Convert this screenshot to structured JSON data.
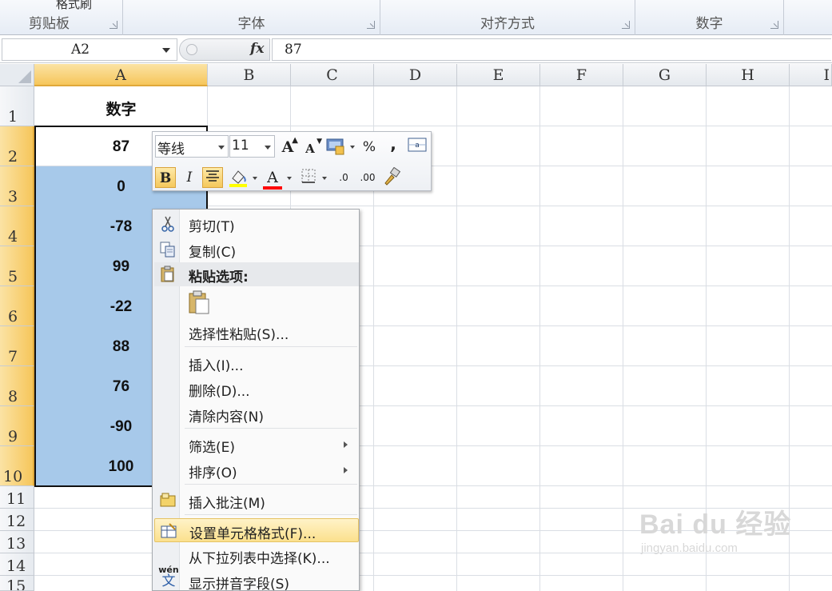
{
  "ribbon": {
    "groups": [
      {
        "label": "剪贴板"
      },
      {
        "label": "字体"
      },
      {
        "label": "对齐方式"
      },
      {
        "label": "数字"
      }
    ],
    "cut_text": "格式刷"
  },
  "formula_bar": {
    "name_box": "A2",
    "fx": "fx",
    "formula": "87"
  },
  "grid": {
    "columns": [
      "A",
      "B",
      "C",
      "D",
      "E",
      "F",
      "G",
      "H",
      "I"
    ],
    "rows": [
      "1",
      "2",
      "3",
      "4",
      "5",
      "6",
      "7",
      "8",
      "9",
      "10",
      "11",
      "12",
      "13",
      "14",
      "15"
    ],
    "cells": {
      "A1": "数字",
      "A2": "87",
      "A3": "0",
      "A4": "-78",
      "A5": "99",
      "A6": "-22",
      "A7": "88",
      "A8": "76",
      "A9": "-90",
      "A10": "100"
    },
    "selected_column": "A",
    "selected_range": "A2:A10",
    "selection_color": "#a7c9ea"
  },
  "mini_toolbar": {
    "font_name": "等线",
    "font_size": "11",
    "grow_font": "A",
    "shrink_font": "A",
    "percent": "%",
    "comma": ",",
    "bold": "B",
    "italic": "I",
    "font_color_letter": "A",
    "highlight_color": "#ffff00",
    "font_color": "#ff0000",
    "decrease_decimal_a": ".0",
    "decrease_decimal_b": ".00"
  },
  "context_menu": {
    "items": [
      {
        "label": "剪切(T)",
        "icon": "scissors-icon"
      },
      {
        "label": "复制(C)",
        "icon": "copy-icon"
      },
      {
        "label": "粘贴选项:",
        "icon": "paste-icon"
      },
      {
        "label": "选择性粘贴(S)...",
        "icon": ""
      },
      {
        "label": "插入(I)...",
        "icon": ""
      },
      {
        "label": "删除(D)...",
        "icon": ""
      },
      {
        "label": "清除内容(N)",
        "icon": ""
      },
      {
        "label": "筛选(E)",
        "icon": "",
        "submenu": true
      },
      {
        "label": "排序(O)",
        "icon": "",
        "submenu": true
      },
      {
        "label": "插入批注(M)",
        "icon": "comment-icon"
      },
      {
        "label": "设置单元格格式(F)...",
        "icon": "format-cells-icon"
      },
      {
        "label": "从下拉列表中选择(K)...",
        "icon": ""
      },
      {
        "label": "显示拼音字段(S)",
        "icon": "pinyin-icon"
      }
    ],
    "pinyin_icon_text": "wén",
    "pinyin_icon_char": "文"
  },
  "watermark": {
    "main": "Bai du 经验",
    "sub": "jingyan.baidu.com"
  }
}
